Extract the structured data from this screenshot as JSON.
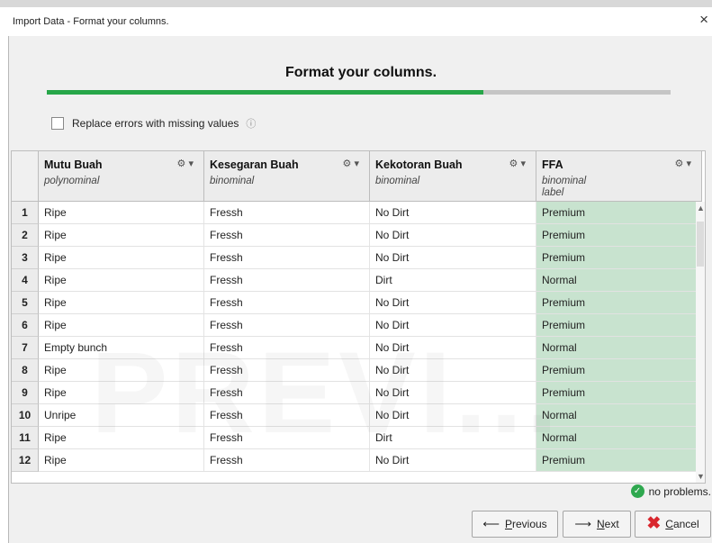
{
  "window": {
    "title": "Import Data - Format your columns.",
    "close_symbol": "×"
  },
  "heading": "Format your columns.",
  "progress": {
    "fraction": 0.7
  },
  "replace_errors": {
    "label": "Replace errors with missing values",
    "checked": false,
    "info_symbol": "ⓘ"
  },
  "columns": [
    {
      "name": "Mutu Buah",
      "type": "polynominal",
      "role": ""
    },
    {
      "name": "Kesegaran Buah",
      "type": "binominal",
      "role": ""
    },
    {
      "name": "Kekotoran Buah",
      "type": "binominal",
      "role": ""
    },
    {
      "name": "FFA",
      "type": "binominal",
      "role": "label"
    }
  ],
  "rows": [
    {
      "n": "1",
      "c": [
        "Ripe",
        "Fressh",
        "No Dirt",
        "Premium"
      ]
    },
    {
      "n": "2",
      "c": [
        "Ripe",
        "Fressh",
        "No Dirt",
        "Premium"
      ]
    },
    {
      "n": "3",
      "c": [
        "Ripe",
        "Fressh",
        "No Dirt",
        "Premium"
      ]
    },
    {
      "n": "4",
      "c": [
        "Ripe",
        "Fressh",
        "Dirt",
        "Normal"
      ]
    },
    {
      "n": "5",
      "c": [
        "Ripe",
        "Fressh",
        "No Dirt",
        "Premium"
      ]
    },
    {
      "n": "6",
      "c": [
        "Ripe",
        "Fressh",
        "No Dirt",
        "Premium"
      ]
    },
    {
      "n": "7",
      "c": [
        "Empty bunch",
        "Fressh",
        "No Dirt",
        "Normal"
      ]
    },
    {
      "n": "8",
      "c": [
        "Ripe",
        "Fressh",
        "No Dirt",
        "Premium"
      ]
    },
    {
      "n": "9",
      "c": [
        "Ripe",
        "Fressh",
        "No Dirt",
        "Premium"
      ]
    },
    {
      "n": "10",
      "c": [
        "Unripe",
        "Fressh",
        "No Dirt",
        "Normal"
      ]
    },
    {
      "n": "11",
      "c": [
        "Ripe",
        "Fressh",
        "Dirt",
        "Normal"
      ]
    },
    {
      "n": "12",
      "c": [
        "Ripe",
        "Fressh",
        "No Dirt",
        "Premium"
      ]
    }
  ],
  "watermark": "PREVI...",
  "status": "no problems.",
  "buttons": {
    "previous": {
      "first": "P",
      "rest": "revious"
    },
    "next": {
      "first": "N",
      "rest": "ext"
    },
    "cancel": {
      "first": "C",
      "rest": "ancel"
    }
  },
  "icons": {
    "gear": "gear-icon",
    "dropdown": "chevron-down-icon",
    "ok": "check-circle-icon",
    "cancel": "red-x-icon",
    "previous": "arrow-left-icon",
    "next": "arrow-right-icon"
  },
  "colors": {
    "progress": "#27a649",
    "label_column": "#c8e3cf",
    "cancel_x": "#d9272e"
  }
}
